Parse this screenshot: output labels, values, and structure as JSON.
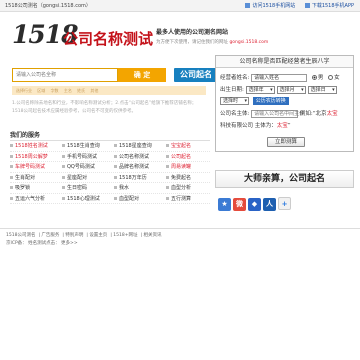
{
  "topbar": {
    "site_title": "1518公司测名（gongsi.1518.com）",
    "links": [
      "访问1518手机网站",
      "下载1518手机APP"
    ]
  },
  "logo": {
    "number": "1518",
    "text": "公司名称测试"
  },
  "tagline": {
    "line1": "最多人使用的公司测名网站",
    "line2_prefix": "为方便下次使用，请记住我们的网址",
    "line2_url": "gongsi.1518.com"
  },
  "search": {
    "placeholder": "请输入公司名全称",
    "confirm_label": "确 定",
    "name_button_label": "公司起名"
  },
  "selector_row": [
    "选择行业",
    "区域",
    "字数",
    "主名",
    "姓氏",
    "其他"
  ],
  "hint": "1.公司名称除去地名和行业，不影响名称测试分析；2.点击“公司起名”给旗下推荐店铺名称；1518公司起名技术应属经验参考，公司名不可变的仅供参考。",
  "panel": {
    "title": "公司名称是否匹配经营者生辰八字",
    "name_label": "经营者姓名:",
    "name_value": "请输入姓名",
    "male": "男",
    "female": "女",
    "birth_label": "出生日期:",
    "dd_year": "选择年",
    "dd_month": "选择月",
    "dd_day": "选择日",
    "dd_hour": "选择时",
    "lunar_badge": "公历农历转换",
    "company_label": "公司名主体:",
    "company_value": "请输入公司名中间主体",
    "example_prefix": "例如:“北京",
    "example_highlight1": "太宝",
    "example_mid": "科技有限公司 主体为：",
    "example_highlight2": "太宝",
    "example_suffix": "”",
    "submit": "立即测算"
  },
  "services": {
    "title": "我们的服务",
    "rows": [
      [
        {
          "text": "1518姓名测试",
          "hl": true
        },
        {
          "text": "1518生肖查询"
        },
        {
          "text": "1518星座查询"
        },
        {
          "text": "宝宝起名",
          "hl": true
        }
      ],
      [
        {
          "text": "1518周公解梦",
          "hl": true
        },
        {
          "text": "手机号码测试"
        },
        {
          "text": "公司名称测试"
        },
        {
          "text": "公司起名",
          "hl": true
        }
      ],
      [
        {
          "text": "车牌号码测试",
          "hl": true
        },
        {
          "text": "QQ号码测试"
        },
        {
          "text": "品牌名称测试"
        },
        {
          "text": "周易读罐",
          "hl": true,
          "hot": true
        }
      ],
      [
        {
          "text": "生肖配对"
        },
        {
          "text": "星座配对"
        },
        {
          "text": "1518万年历"
        },
        {
          "text": "免费起名"
        }
      ],
      [
        {
          "text": "吸罗锁"
        },
        {
          "text": "生日密码"
        },
        {
          "text": "我水"
        },
        {
          "text": "血型分析"
        }
      ],
      [
        {
          "text": "五运六气分析"
        },
        {
          "text": "1518心理测试"
        },
        {
          "text": "血型配对"
        },
        {
          "text": "五行测算"
        }
      ]
    ]
  },
  "side_button": "大师亲算，公司起名",
  "share_icons": [
    "qzone-icon",
    "weibo-icon",
    "baidu-icon",
    "renren-icon",
    "more-icon"
  ],
  "footer": {
    "links": [
      "1518公司测名",
      "广告服务",
      "特别声明",
      "设置主页",
      "1518+网址",
      "相关资讯"
    ],
    "line2": "京ICP备：  姓名测试点击：  更多>>"
  }
}
